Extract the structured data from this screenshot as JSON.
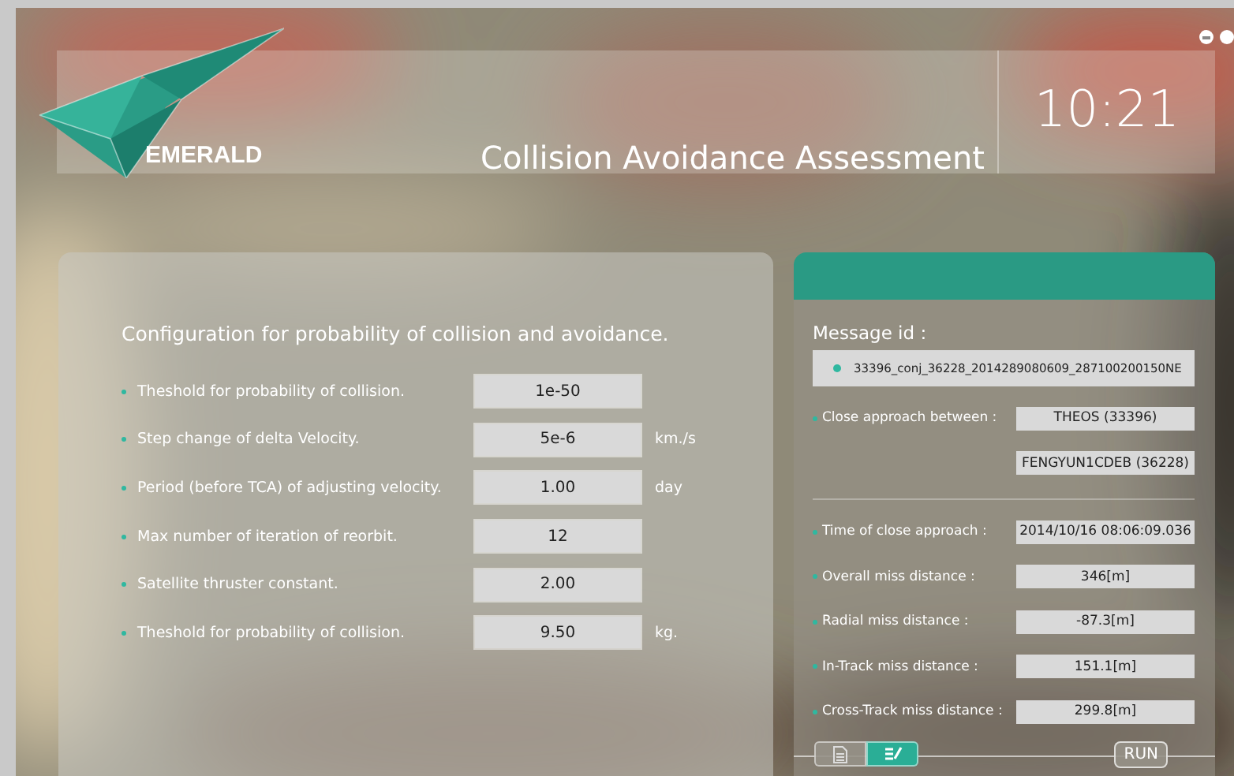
{
  "header": {
    "logo_text": "EMERALD",
    "title": "Collision Avoidance Assessment",
    "clock": "10:21"
  },
  "config": {
    "title": "Configuration for probability of collision and avoidance.",
    "rows": [
      {
        "label": "Theshold for probability of collision.",
        "value": "1e-50"
      },
      {
        "label": "Step change of delta Velocity.",
        "value": "5e-6",
        "unit": "km./s"
      },
      {
        "label": "Period (before TCA) of adjusting velocity.",
        "value": "1.00",
        "unit": "day"
      },
      {
        "label": "Max number of iteration of reorbit.",
        "value": "12"
      },
      {
        "label": "Satellite thruster constant.",
        "value": "2.00"
      },
      {
        "label": "Theshold for probability of collision.",
        "value": "9.50",
        "unit": "kg."
      }
    ]
  },
  "message": {
    "label": "Message id :",
    "id": "33396_conj_36228_2014289080609_287100200150NE",
    "close_approach": {
      "label": "Close approach between :",
      "values": [
        "THEOS (33396)",
        "FENGYUN1CDEB (36228)"
      ]
    },
    "rows": [
      {
        "label": "Time of close approach :",
        "value": "2014/10/16 08:06:09.036"
      },
      {
        "label": "Overall miss distance :",
        "value": "346[m]"
      },
      {
        "label": "Radial miss distance :",
        "value": "-87.3[m]"
      },
      {
        "label": "In-Track miss distance :",
        "value": "151.1[m]"
      },
      {
        "label": "Cross-Track miss distance :",
        "value": "299.8[m]"
      }
    ],
    "tabs": [
      {
        "kind": "document",
        "selected": false
      },
      {
        "kind": "edit",
        "selected": true
      }
    ],
    "run_button": "RUN"
  }
}
